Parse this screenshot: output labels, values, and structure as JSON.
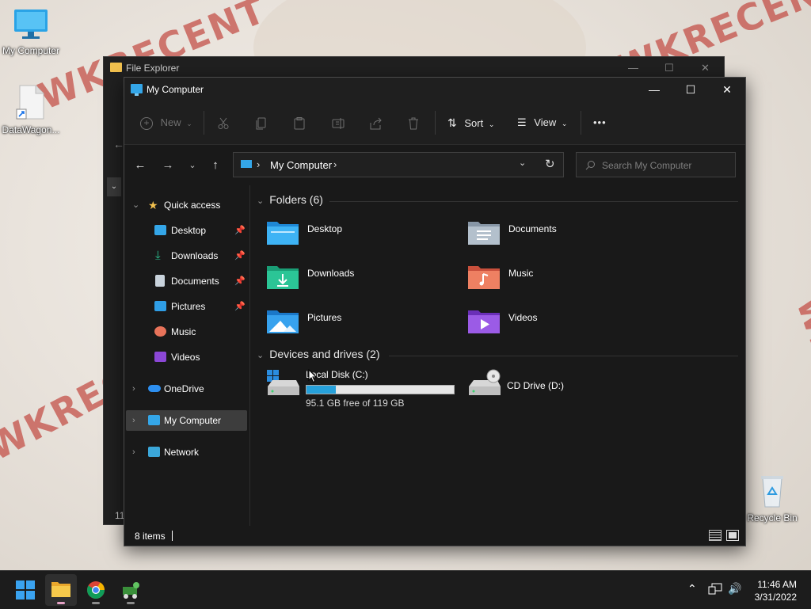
{
  "desktop": {
    "icons": [
      {
        "label": "My Computer"
      },
      {
        "label": "DataWagon..."
      },
      {
        "label": "Recycle Bin"
      }
    ],
    "wallpaper_text": "WKRECENT"
  },
  "back_window": {
    "title": "File Explorer",
    "status_fragment": "11"
  },
  "window": {
    "title": "My Computer",
    "controls": {
      "minimize": "—",
      "maximize": "☐",
      "close": "✕"
    }
  },
  "toolbar": {
    "new_label": "New",
    "sort_label": "Sort",
    "view_label": "View",
    "more_label": "•••"
  },
  "address": {
    "path": "My Computer",
    "search_placeholder": "Search My Computer"
  },
  "nav": {
    "quick_access": "Quick access",
    "items": [
      {
        "label": "Desktop",
        "pinned": true
      },
      {
        "label": "Downloads",
        "pinned": true
      },
      {
        "label": "Documents",
        "pinned": true
      },
      {
        "label": "Pictures",
        "pinned": true
      },
      {
        "label": "Music",
        "pinned": false
      },
      {
        "label": "Videos",
        "pinned": false
      }
    ],
    "onedrive": "OneDrive",
    "my_computer": "My Computer",
    "network": "Network"
  },
  "content": {
    "folders_header": "Folders (6)",
    "folders": [
      {
        "name": "Desktop",
        "icon": "desktop-folder-icon"
      },
      {
        "name": "Documents",
        "icon": "documents-folder-icon"
      },
      {
        "name": "Downloads",
        "icon": "downloads-folder-icon"
      },
      {
        "name": "Music",
        "icon": "music-folder-icon"
      },
      {
        "name": "Pictures",
        "icon": "pictures-folder-icon"
      },
      {
        "name": "Videos",
        "icon": "videos-folder-icon"
      }
    ],
    "drives_header": "Devices and drives (2)",
    "drives": [
      {
        "name": "Local Disk (C:)",
        "free_text": "95.1 GB free of 119 GB",
        "used_fraction": 0.2
      },
      {
        "name": "CD Drive (D:)"
      }
    ]
  },
  "status": {
    "item_count": "8 items"
  },
  "taskbar": {
    "time": "11:46 AM",
    "date": "3/31/2022"
  },
  "colors": {
    "accent": "#26a0da",
    "window_bg": "#191919",
    "selected_nav": "#3d3d3d"
  }
}
